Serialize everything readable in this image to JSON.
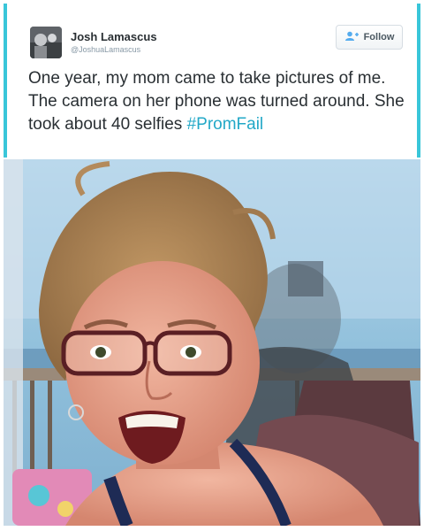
{
  "tweet": {
    "author_name": "Josh Lamascus",
    "author_handle": "@JoshuaLamascus",
    "follow_label": "Follow",
    "text": "One year, my mom came to take pictures of me. The camera on her phone was turned around. She took about 40 selfies ",
    "hashtag": "#PromFail"
  },
  "icons": {
    "follow": "add-user-icon",
    "avatar": "avatar-image"
  },
  "colors": {
    "accent": "#39c6d9",
    "hashtag": "#22a8c7",
    "text": "#292f33",
    "muted": "#8899a6"
  }
}
